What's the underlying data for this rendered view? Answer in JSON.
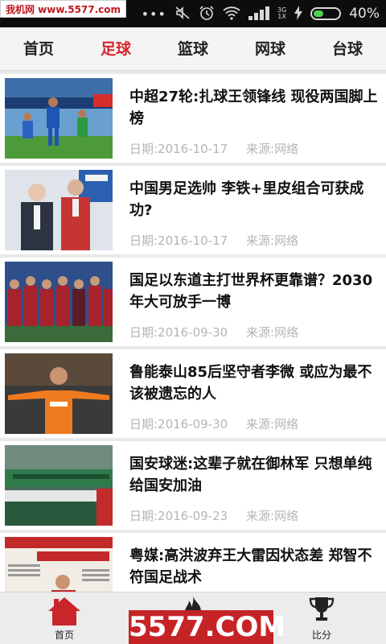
{
  "status_bar": {
    "watermark": "我机网 www.5577.com",
    "battery_percent": "40%",
    "battery_level": 0.4,
    "network_top": "3G",
    "network_bottom": "1X",
    "colors": {
      "battery_fill": "#4fd14f"
    }
  },
  "tabs": [
    {
      "label": "首页",
      "active": false
    },
    {
      "label": "足球",
      "active": true
    },
    {
      "label": "篮球",
      "active": false
    },
    {
      "label": "网球",
      "active": false
    },
    {
      "label": "台球",
      "active": false
    }
  ],
  "news": [
    {
      "title": "中超27轮:扎球王领锋线 现役两国脚上榜",
      "date": "日期:2016-10-17",
      "source": "来源:网络"
    },
    {
      "title": "中国男足选帅 李铁+里皮组合可获成功?",
      "date": "日期:2016-10-17",
      "source": "来源:网络"
    },
    {
      "title": "国足以东道主打世界杯更靠谱？2030年大可放手一博",
      "date": "日期:2016-09-30",
      "source": "来源:网络"
    },
    {
      "title": "鲁能泰山85后坚守者李微 或应为最不该被遗忘的人",
      "date": "日期:2016-09-30",
      "source": "来源:网络"
    },
    {
      "title": "国安球迷:这辈子就在御林军 只想单纯给国安加油",
      "date": "日期:2016-09-23",
      "source": "来源:网络"
    },
    {
      "title": "粤媒:高洪波弃王大雷因状态差 郑智不符国足战术",
      "date": "",
      "source": ""
    }
  ],
  "bottom_nav": [
    {
      "label": "首页",
      "icon": "home-icon"
    },
    {
      "label": "",
      "icon": "flame-icon"
    },
    {
      "label": "比分",
      "icon": "trophy-icon"
    }
  ],
  "watermark_bottom": "5577.COM",
  "colors": {
    "accent": "#d8252c",
    "tab_bar": "#f4f4f4",
    "bottom_bar": "#ececec"
  }
}
